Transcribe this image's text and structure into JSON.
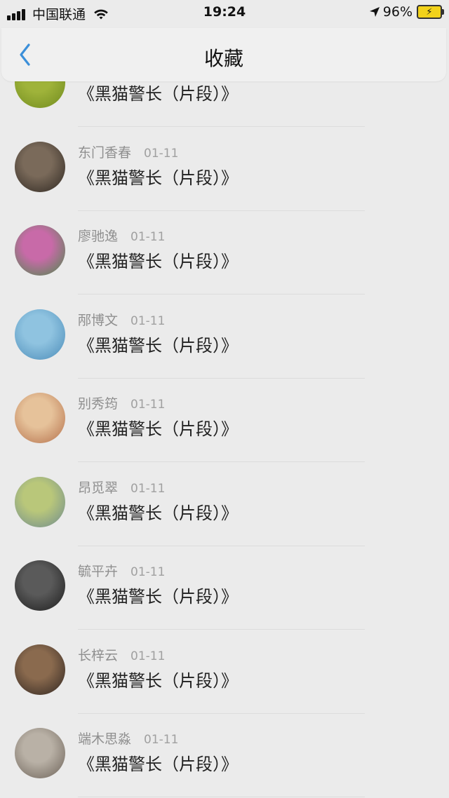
{
  "status_bar": {
    "carrier": "中国联通",
    "time": "19:24",
    "battery_percent": "96%",
    "battery_icon_glyph": "⚡"
  },
  "nav": {
    "title": "收藏",
    "back_icon": "chevron-left-icon"
  },
  "favorites": [
    {
      "author": "",
      "date": "",
      "title": "《黑猫警长（片段）》",
      "avatar_colors": [
        "#9fb33a",
        "#6f8a1e"
      ]
    },
    {
      "author": "东门香春",
      "date": "01-11",
      "title": "《黑猫警长（片段）》",
      "avatar_colors": [
        "#7a6a5a",
        "#2d2620"
      ]
    },
    {
      "author": "廖驰逸",
      "date": "01-11",
      "title": "《黑猫警长（片段）》",
      "avatar_colors": [
        "#c86aa8",
        "#4a8a4a"
      ]
    },
    {
      "author": "邴博文",
      "date": "01-11",
      "title": "《黑猫警长（片段）》",
      "avatar_colors": [
        "#8fc3e0",
        "#4a8bb8"
      ]
    },
    {
      "author": "别秀筠",
      "date": "01-11",
      "title": "《黑猫警长（片段）》",
      "avatar_colors": [
        "#e6c29a",
        "#b46f4a"
      ]
    },
    {
      "author": "昂觅翠",
      "date": "01-11",
      "title": "《黑猫警长（片段）》",
      "avatar_colors": [
        "#b9c77a",
        "#6d8a8f"
      ]
    },
    {
      "author": "毓平卉",
      "date": "01-11",
      "title": "《黑猫警长（片段）》",
      "avatar_colors": [
        "#5a5a5a",
        "#1c1c1c"
      ]
    },
    {
      "author": "长梓云",
      "date": "01-11",
      "title": "《黑猫警长（片段）》",
      "avatar_colors": [
        "#8a6a4e",
        "#2e2420"
      ]
    },
    {
      "author": "端木思淼",
      "date": "01-11",
      "title": "《黑猫警长（片段）》",
      "avatar_colors": [
        "#b9b1a6",
        "#6b6157"
      ]
    }
  ]
}
